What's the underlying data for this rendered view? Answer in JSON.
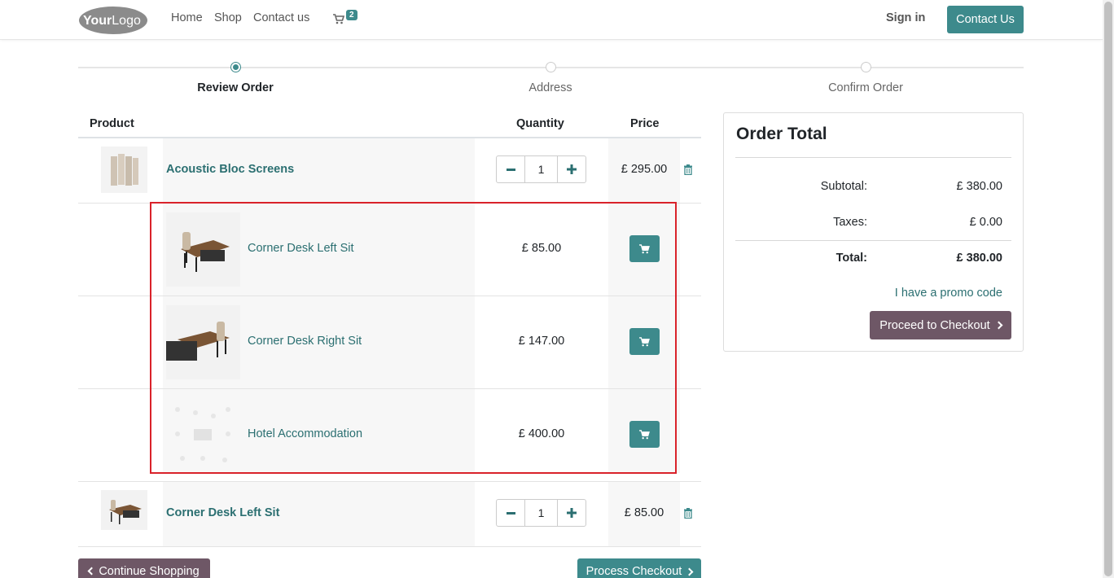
{
  "header": {
    "logo_text": "YourLogo",
    "nav": [
      "Home",
      "Shop",
      "Contact us"
    ],
    "cart_count": "2",
    "sign_in": "Sign in",
    "contact_button": "Contact Us"
  },
  "steps": [
    {
      "label": "Review Order",
      "active": true
    },
    {
      "label": "Address",
      "active": false
    },
    {
      "label": "Confirm Order",
      "active": false
    }
  ],
  "cart": {
    "columns": [
      "Product",
      "Quantity",
      "Price"
    ],
    "lines": [
      {
        "name": "Acoustic Bloc Screens",
        "quantity": "1",
        "price": "£ 295.00"
      },
      {
        "name": "Corner Desk Left Sit",
        "quantity": "1",
        "price": "£ 85.00"
      }
    ],
    "optional_products": [
      {
        "name": "Corner Desk Left Sit",
        "price": "£ 85.00"
      },
      {
        "name": "Corner Desk Right Sit",
        "price": "£ 147.00"
      },
      {
        "name": "Hotel Accommodation",
        "price": "£ 400.00"
      }
    ],
    "continue_shopping": "Continue Shopping",
    "process_checkout": "Process Checkout"
  },
  "order_total": {
    "title": "Order Total",
    "subtotal_label": "Subtotal:",
    "subtotal_value": "£ 380.00",
    "taxes_label": "Taxes:",
    "taxes_value": "£ 0.00",
    "total_label": "Total:",
    "total_value": "£ 380.00",
    "promo_link": "I have a promo code",
    "proceed_button": "Proceed to Checkout"
  },
  "colors": {
    "primary": "#3d8a8c",
    "secondary": "#6e5766",
    "link": "#2b6f71",
    "highlight_border": "#d9222a"
  }
}
